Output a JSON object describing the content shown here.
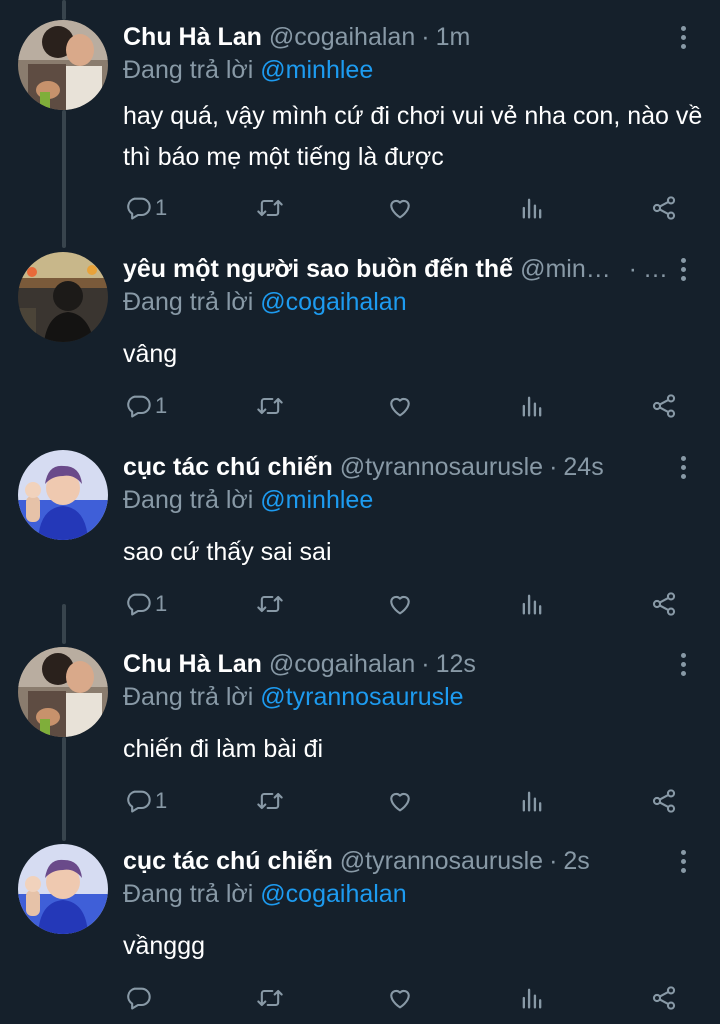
{
  "tweets": [
    {
      "name": "Chu Hà Lan",
      "handle": "@cogaihalan",
      "time": "1m",
      "replying_to_label": "Đang trả lời",
      "replying_to": "@minhlee",
      "text": "hay quá, vậy mình cứ đi chơi vui vẻ nha con, nào về thì báo mẹ một tiếng là được",
      "reply_count": "1"
    },
    {
      "name": "yêu một người sao buồn đến thế",
      "handle": "@minhlee",
      "time": "…",
      "replying_to_label": "Đang trả lời",
      "replying_to": "@cogaihalan",
      "text": "vâng",
      "reply_count": "1"
    },
    {
      "name": "cục tác chú chiến",
      "handle": "@tyrannosaurusle",
      "time": "24s",
      "replying_to_label": "Đang trả lời",
      "replying_to": "@minhlee",
      "text": "sao cứ thấy sai sai",
      "reply_count": "1"
    },
    {
      "name": "Chu Hà Lan",
      "handle": "@cogaihalan",
      "time": "12s",
      "replying_to_label": "Đang trả lời",
      "replying_to": "@tyrannosaurusle",
      "text": "chiến đi làm bài đi",
      "reply_count": "1"
    },
    {
      "name": "cục tác chú chiến",
      "handle": "@tyrannosaurusle",
      "time": "2s",
      "replying_to_label": "Đang trả lời",
      "replying_to": "@cogaihalan",
      "text": "vầnggg",
      "reply_count": ""
    }
  ],
  "separator": "·",
  "icons": {
    "reply": "reply-icon",
    "retweet": "retweet-icon",
    "like": "like-icon",
    "analytics": "analytics-icon",
    "share": "share-icon",
    "more": "more-options-icon"
  },
  "colors": {
    "background": "#15202b",
    "text": "#ffffff",
    "secondary": "#8899a6",
    "mention": "#1d9bf0",
    "thread_line": "#38444d"
  }
}
